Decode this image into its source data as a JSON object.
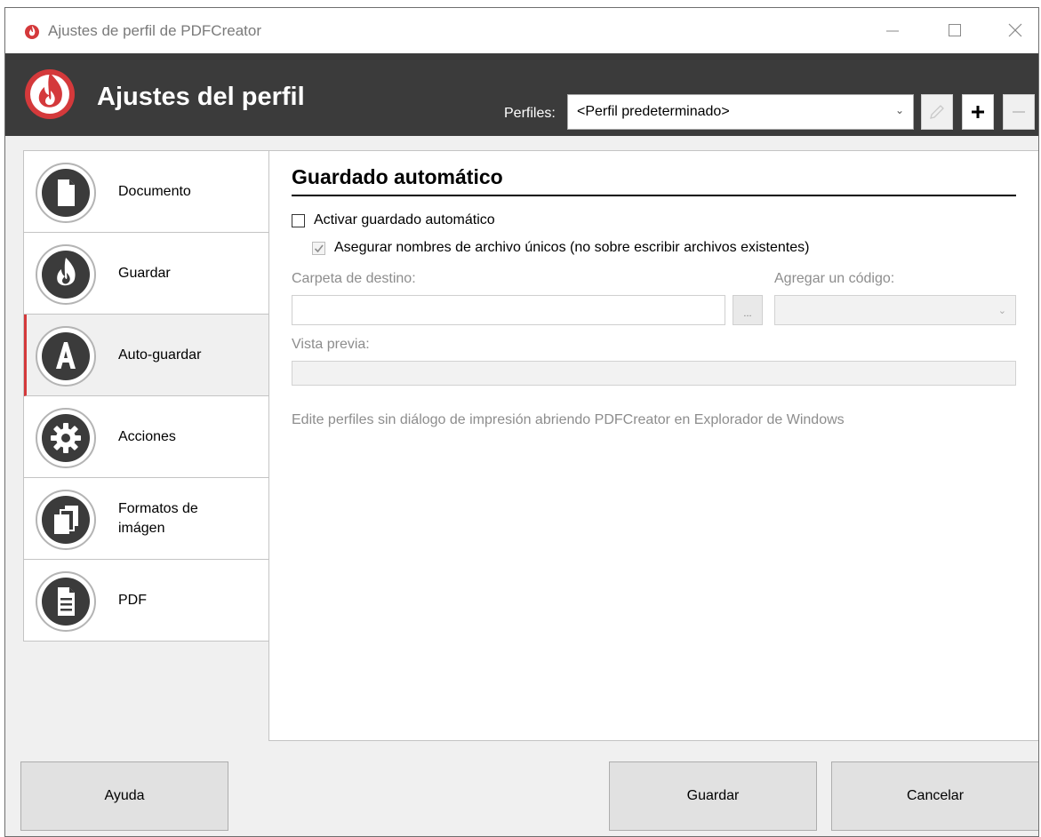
{
  "window": {
    "title": "Ajustes de perfil de PDFCreator",
    "controls": [
      "minimize-icon",
      "maximize-icon",
      "close-icon"
    ]
  },
  "header": {
    "title": "Ajustes del perfil",
    "profiles_label": "Perfiles:",
    "profile_selected": "<Perfil predeterminado>",
    "buttons": [
      "pencil-icon",
      "plus-icon",
      "minus-icon"
    ]
  },
  "colors": {
    "brand_red": "#d4393b",
    "header_bg": "#3b3b3b",
    "active_accent": "#d4393b"
  },
  "sidebar": {
    "items": [
      {
        "label": "Documento",
        "icon": "document-icon",
        "active": false
      },
      {
        "label": "Guardar",
        "icon": "flame-icon",
        "active": false
      },
      {
        "label": "Auto-guardar",
        "icon": "letter-a-icon",
        "active": true
      },
      {
        "label": "Acciones",
        "icon": "gear-icon",
        "active": false
      },
      {
        "label": "Formatos de imágen",
        "icon": "stacked-pages-icon",
        "active": false
      },
      {
        "label": "PDF",
        "icon": "pdf-page-icon",
        "active": false
      }
    ]
  },
  "main": {
    "section_title": "Guardado automático",
    "activate_label": "Activar guardado automático",
    "activate_checked": false,
    "unique_names_label": "Asegurar nombres de archivo únicos (no sobre escribir archivos existentes)",
    "unique_names_checked": true,
    "target_folder_label": "Carpeta de destino:",
    "target_folder_value": "",
    "browse_label": "...",
    "add_token_label": "Agregar un código:",
    "add_token_value": "",
    "preview_label": "Vista previa:",
    "preview_value": "",
    "info_text": "Edite perfiles sin diálogo de impresión abriendo PDFCreator en Explorador de Windows"
  },
  "footer": {
    "help": "Ayuda",
    "save": "Guardar",
    "cancel": "Cancelar"
  }
}
